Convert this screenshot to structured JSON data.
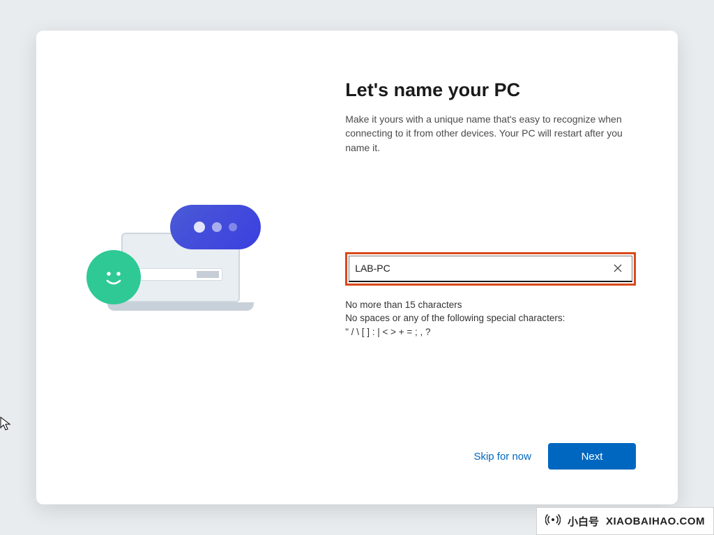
{
  "header": {
    "title": "Let's name your PC",
    "subtitle": "Make it yours with a unique name that's easy to recognize when connecting to it from other devices. Your PC will restart after you name it."
  },
  "input": {
    "value": "LAB-PC",
    "placeholder": ""
  },
  "hints": {
    "line1": "No more than 15 characters",
    "line2": "No spaces or any of the following special characters:",
    "line3": "\" / \\ [ ] : | < > + = ; , ?"
  },
  "footer": {
    "skip_label": "Skip for now",
    "next_label": "Next"
  },
  "watermark": {
    "icon": "((·))",
    "cn_text": "小白号",
    "url_text": "XIAOBAIHAO.COM"
  }
}
